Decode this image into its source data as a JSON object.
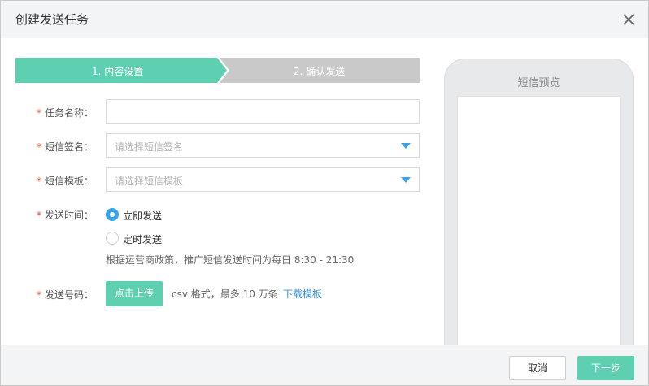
{
  "dialog": {
    "title": "创建发送任务",
    "close_icon": "close-icon"
  },
  "steps": [
    {
      "label": "1. 内容设置",
      "active": true,
      "color": "#5fcfb1"
    },
    {
      "label": "2. 确认发送",
      "active": false,
      "color": "#c9c9c9"
    }
  ],
  "form": {
    "required_mark": "*",
    "task_name": {
      "label": "任务名称：",
      "value": "",
      "placeholder": ""
    },
    "sms_signature": {
      "label": "短信签名：",
      "placeholder": "请选择短信签名"
    },
    "sms_template": {
      "label": "短信模板：",
      "placeholder": "请选择短信模板"
    },
    "send_time": {
      "label": "发送时间：",
      "options": [
        {
          "label": "立即发送",
          "selected": true
        },
        {
          "label": "定时发送",
          "selected": false
        }
      ],
      "hint": "根据运营商政策，推广短信发送时间为每日 8:30 - 21:30"
    },
    "send_numbers": {
      "label": "发送号码：",
      "upload_label": "点击上传",
      "note": "csv 格式，最多 10 万条",
      "download_link": "下载模板"
    }
  },
  "preview": {
    "title": "短信预览"
  },
  "footer": {
    "cancel_label": "取消",
    "next_label": "下一步"
  },
  "colors": {
    "accent": "#5fcfb1",
    "link": "#3a8fd9",
    "radio": "#3ba2e4",
    "required": "#e34a3d"
  }
}
